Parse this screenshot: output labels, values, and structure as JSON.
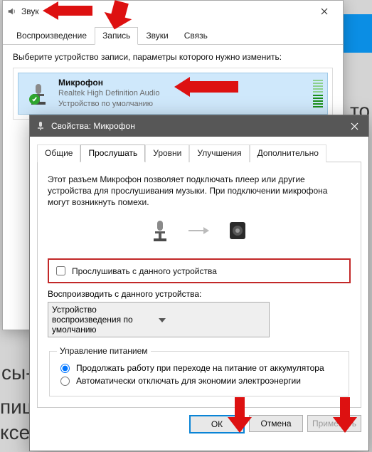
{
  "bg": {
    "t1": "то",
    "t2": "сы-",
    "t3": "пиш",
    "t4": "ксе"
  },
  "sound_window": {
    "title": "Звук",
    "tabs": [
      "Воспроизведение",
      "Запись",
      "Звуки",
      "Связь"
    ],
    "active_tab": 1,
    "hint": "Выберите устройство записи, параметры которого нужно изменить:",
    "device": {
      "name": "Микрофон",
      "desc": "Realtek High Definition Audio",
      "default": "Устройство по умолчанию"
    }
  },
  "props_window": {
    "title": "Свойства: Микрофон",
    "tabs": [
      "Общие",
      "Прослушать",
      "Уровни",
      "Улучшения",
      "Дополнительно"
    ],
    "active_tab": 1,
    "paragraph": "Этот разъем Микрофон позволяет подключать плеер или другие устройства для прослушивания музыки. При подключении микрофона могут возникнуть помехи.",
    "listen_checkbox": "Прослушивать с данного устройства",
    "playthru_label": "Воспроизводить с данного устройства:",
    "playthru_value": "Устройство воспроизведения по умолчанию",
    "pm_legend": "Управление питанием",
    "pm_opt1": "Продолжать работу при переходе на питание от аккумулятора",
    "pm_opt2": "Автоматически отключать для экономии электроэнергии",
    "buttons": {
      "ok": "ОК",
      "cancel": "Отмена",
      "apply": "Применить"
    }
  }
}
